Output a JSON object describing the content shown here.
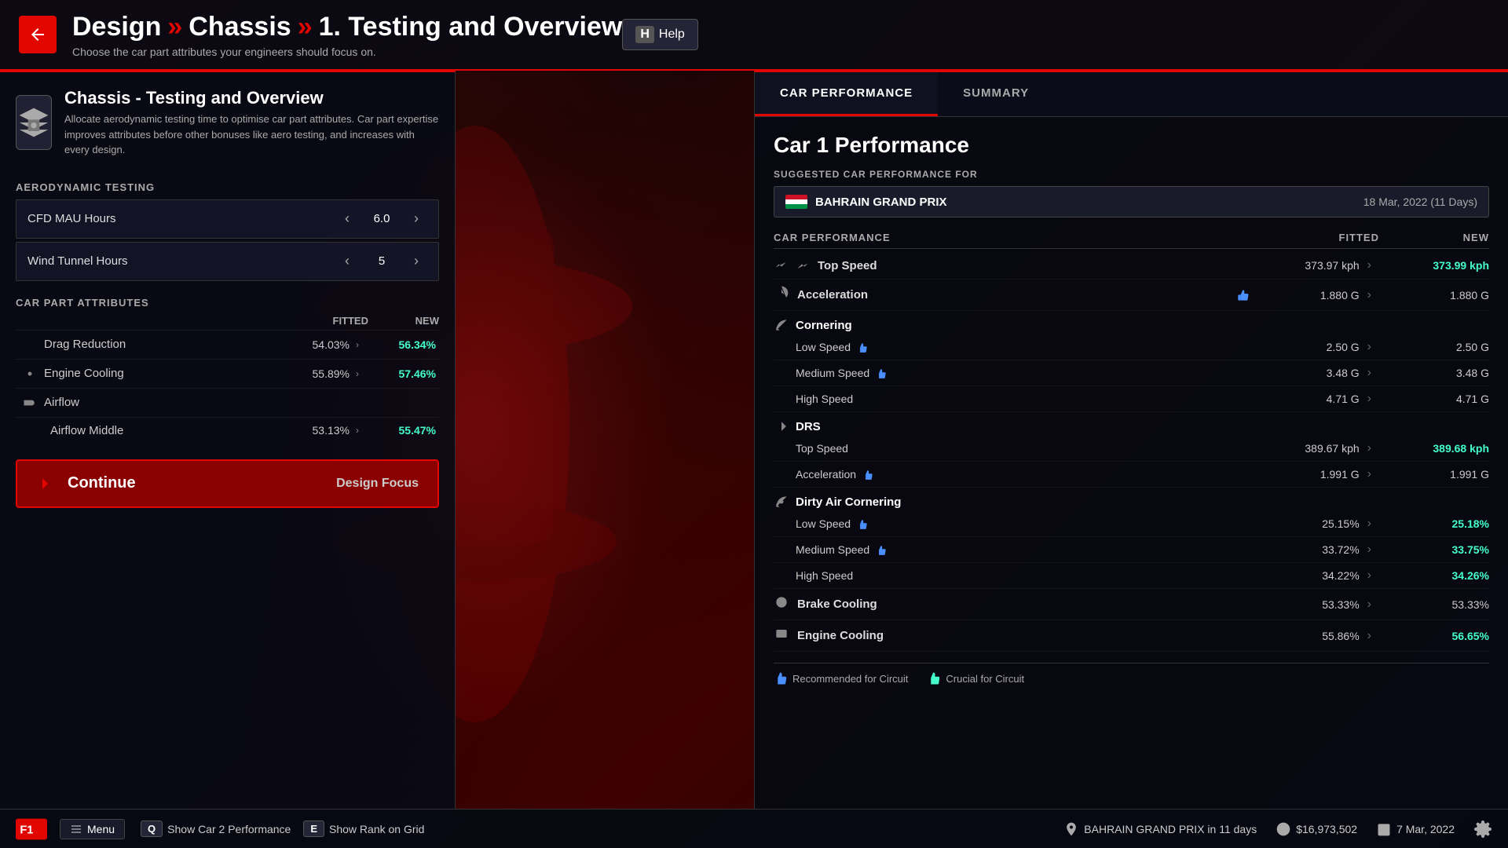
{
  "header": {
    "back_label": "back",
    "breadcrumb": {
      "root": "Design",
      "mid": "Chassis",
      "current": "1. Testing and Overview"
    },
    "subtitle": "Choose the car part attributes your engineers should focus on.",
    "help_key": "H",
    "help_label": "Help"
  },
  "left_panel": {
    "icon_label": "chassis-icon",
    "title": "Chassis - Testing and Overview",
    "description": "Allocate aerodynamic testing time to optimise car part attributes. Car part expertise improves attributes before other bonuses like aero testing, and increases with every design.",
    "aero_section": "AERODYNAMIC TESTING",
    "spinners": [
      {
        "label": "CFD MAU Hours",
        "value": "6.0"
      },
      {
        "label": "Wind Tunnel Hours",
        "value": "5"
      }
    ],
    "attr_section": "CAR PART ATTRIBUTES",
    "attr_headers": {
      "fitted": "FITTED",
      "new": "NEW"
    },
    "attributes": [
      {
        "name": "Drag Reduction",
        "fitted": "54.03%",
        "new": "56.34%",
        "indent": false
      },
      {
        "name": "Engine Cooling",
        "fitted": "55.89%",
        "new": "57.46%",
        "indent": false
      },
      {
        "name": "Airflow",
        "fitted": "",
        "new": "",
        "indent": false,
        "header": true
      },
      {
        "name": "Airflow Middle",
        "fitted": "53.13%",
        "new": "55.47%",
        "indent": true
      }
    ],
    "continue_label": "Continue",
    "design_focus": "Design Focus"
  },
  "right_panel": {
    "tabs": [
      {
        "label": "CAR PERFORMANCE",
        "active": true
      },
      {
        "label": "SUMMARY",
        "active": false
      }
    ],
    "perf_title": "Car 1 Performance",
    "suggested_label": "SUGGESTED CAR PERFORMANCE FOR",
    "grand_prix": {
      "name": "BAHRAIN GRAND PRIX",
      "date": "18 Mar, 2022 (11 Days)"
    },
    "perf_headers": {
      "fitted": "FITTED",
      "new": "NEW"
    },
    "categories": [
      {
        "name": "Top Speed",
        "icon": "speed-icon",
        "type": "main",
        "fitted": "373.97 kph",
        "new": "373.99 kph",
        "improved": true,
        "has_thumb": false
      },
      {
        "name": "Acceleration",
        "icon": "accel-icon",
        "type": "main",
        "fitted": "1.880 G",
        "new": "1.880 G",
        "improved": false,
        "has_thumb": true,
        "thumb_type": "recommended"
      },
      {
        "name": "Cornering",
        "icon": "corner-icon",
        "type": "category",
        "children": [
          {
            "name": "Low Speed",
            "fitted": "2.50 G",
            "new": "2.50 G",
            "improved": false,
            "has_thumb": true,
            "thumb_type": "recommended"
          },
          {
            "name": "Medium Speed",
            "fitted": "3.48 G",
            "new": "3.48 G",
            "improved": false,
            "has_thumb": true,
            "thumb_type": "recommended"
          },
          {
            "name": "High Speed",
            "fitted": "4.71 G",
            "new": "4.71 G",
            "improved": false,
            "has_thumb": false
          }
        ]
      },
      {
        "name": "DRS",
        "icon": "drs-icon",
        "type": "category",
        "children": [
          {
            "name": "Top Speed",
            "fitted": "389.67 kph",
            "new": "389.68 kph",
            "improved": true,
            "has_thumb": false
          },
          {
            "name": "Acceleration",
            "fitted": "1.991 G",
            "new": "1.991 G",
            "improved": false,
            "has_thumb": true,
            "thumb_type": "recommended"
          }
        ]
      },
      {
        "name": "Dirty Air Cornering",
        "icon": "dirty-corner-icon",
        "type": "category",
        "children": [
          {
            "name": "Low Speed",
            "fitted": "25.15%",
            "new": "25.18%",
            "improved": true,
            "has_thumb": true,
            "thumb_type": "recommended"
          },
          {
            "name": "Medium Speed",
            "fitted": "33.72%",
            "new": "33.75%",
            "improved": true,
            "has_thumb": true,
            "thumb_type": "recommended"
          },
          {
            "name": "High Speed",
            "fitted": "34.22%",
            "new": "34.26%",
            "improved": true,
            "has_thumb": false
          }
        ]
      },
      {
        "name": "Brake Cooling",
        "icon": "brake-icon",
        "type": "main",
        "fitted": "53.33%",
        "new": "53.33%",
        "improved": false,
        "has_thumb": false
      },
      {
        "name": "Engine Cooling",
        "icon": "engine-icon",
        "type": "main",
        "fitted": "55.86%",
        "new": "56.65%",
        "improved": true,
        "has_thumb": false
      }
    ],
    "legend": [
      {
        "icon": "thumb-recommended-icon",
        "label": "Recommended for Circuit"
      },
      {
        "icon": "thumb-crucial-icon",
        "label": "Crucial for Circuit"
      }
    ]
  },
  "bottom_bar": {
    "menu_label": "Menu",
    "quick_actions": [
      {
        "key": "Q",
        "label": "Show Car 2 Performance"
      },
      {
        "key": "E",
        "label": "Show Rank on Grid"
      }
    ],
    "gp_info": "BAHRAIN GRAND PRIX in 11 days",
    "money": "$16,973,502",
    "date": "7 Mar, 2022"
  }
}
